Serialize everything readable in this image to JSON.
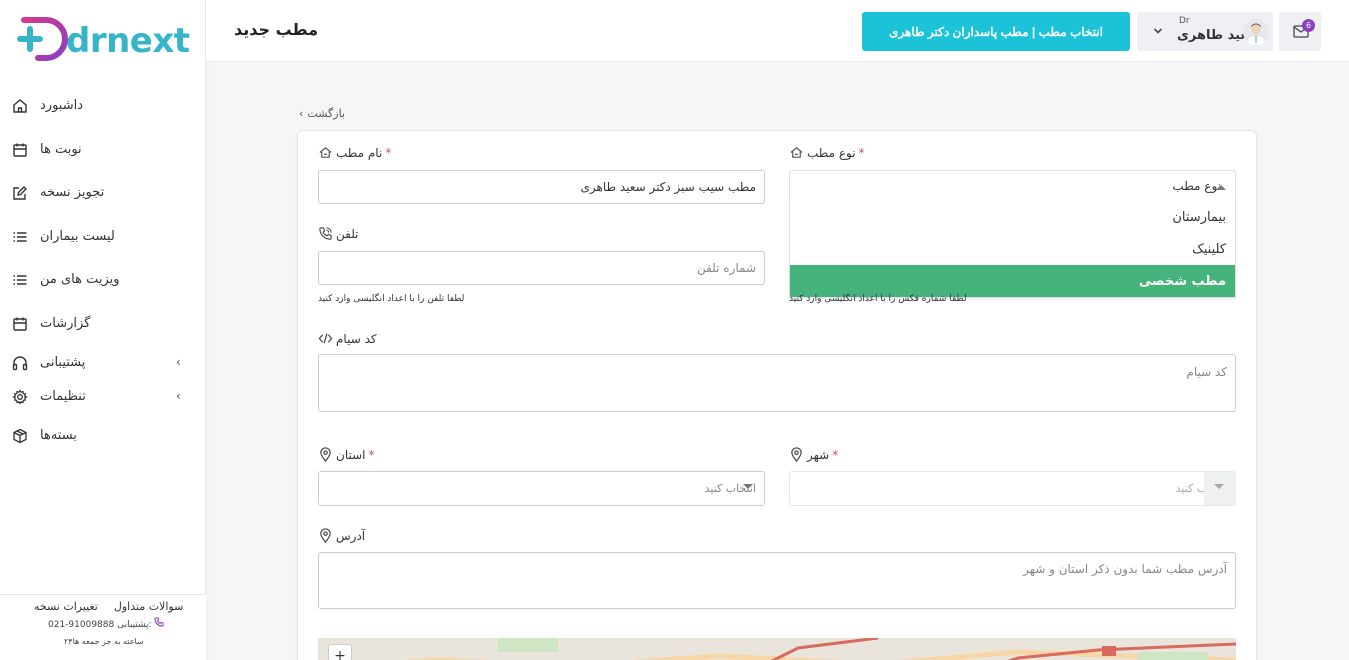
{
  "brand": {
    "logo_text": "drnext",
    "accent": "#1cc2d8",
    "brand_purple": "#8a3fbf",
    "brand_pink": "#d23a8f"
  },
  "sidebar": {
    "items": [
      {
        "label": "داشبورد",
        "icon": "home-icon"
      },
      {
        "label": "نوبت ها",
        "icon": "calendar-icon"
      },
      {
        "label": "تجویز نسخه",
        "icon": "edit-icon"
      },
      {
        "label": "لیست بیماران",
        "icon": "list-icon"
      },
      {
        "label": "ویزیت های من",
        "icon": "list-icon"
      },
      {
        "label": "گزارشات",
        "icon": "calendar-icon"
      },
      {
        "label": "پشتیبانی",
        "icon": "headphones-icon",
        "has_submenu": true
      },
      {
        "label": "تنظیمات",
        "icon": "gear-icon",
        "has_submenu": true
      },
      {
        "label": "بسته‌ها",
        "icon": "package-icon"
      }
    ],
    "footer": {
      "faq": "سوالات متداول",
      "changelog": "تغییرات نسخه",
      "support_label": "پشتیبانی:",
      "support_phone": "021-91009888",
      "hours": "۲۴ساعته به جز جمعه ها"
    }
  },
  "topbar": {
    "page_title": "مطب جدید",
    "clinic_button": "انتخاب مطب | مطب پاسداران دکتر طاهری",
    "user": {
      "prefix": "Dr",
      "name": "سعید طاهری"
    },
    "notifications_count": "6"
  },
  "form": {
    "back": "بازگشت",
    "clinic_type": {
      "label": "نوع مطب",
      "required_mark": "*",
      "placeholder": "نوع مطب",
      "options": [
        "بیمارستان",
        "کلینیک",
        "مطب شخصی"
      ],
      "highlighted": "مطب شخصی",
      "highlight_color": "#47b37c"
    },
    "clinic_name": {
      "label": "نام مطب",
      "required_mark": "*",
      "value": "مطب سیب سبز دکتر سعید طاهری"
    },
    "phone": {
      "label": "تلفن",
      "placeholder": "شماره تلفن",
      "hint": "لطفا تلفن را با اعداد انگلیسی وارد کنید"
    },
    "fax_hint": "لطفا شماره فکس را با اعداد انگلیسی وارد کنید",
    "siam_code": {
      "label": "کد سیام",
      "placeholder": "کد سیام"
    },
    "province": {
      "label": "استان",
      "required_mark": "*",
      "placeholder": "انتخاب کنید"
    },
    "city": {
      "label": "شهر",
      "required_mark": "*",
      "placeholder": "انتخاب کنید"
    },
    "address": {
      "label": "آدرس",
      "placeholder": "آدرس مطب شما بدون ذکر استان و شهر"
    },
    "map": {
      "zoom_in": "+"
    }
  }
}
